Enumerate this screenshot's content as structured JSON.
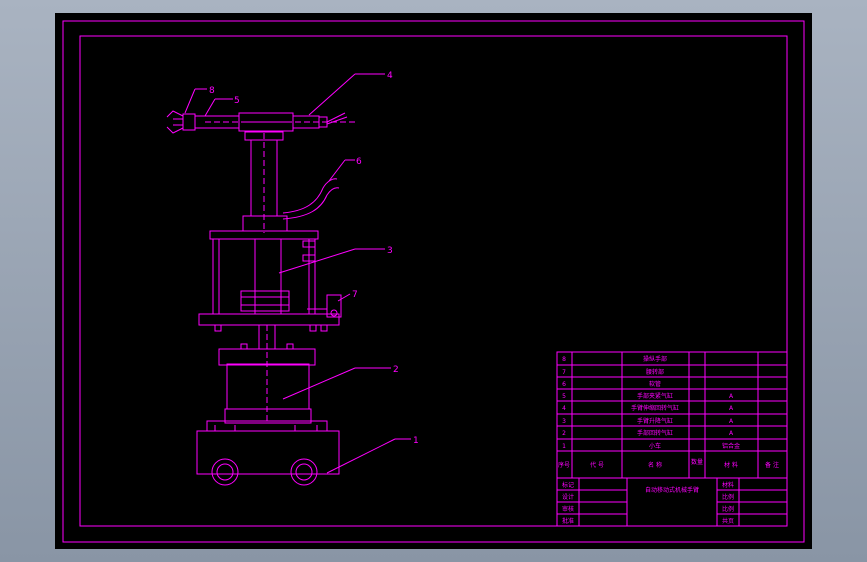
{
  "drawing": {
    "line_color": "#ff00ff",
    "background": "#000000",
    "callouts": [
      "1",
      "2",
      "3",
      "4",
      "5",
      "6",
      "7",
      "8"
    ],
    "parts_list": [
      {
        "no": "8",
        "name": "操纵手部",
        "qty": "",
        "material": "",
        "note": ""
      },
      {
        "no": "7",
        "name": "腰转部",
        "qty": "",
        "material": "",
        "note": ""
      },
      {
        "no": "6",
        "name": "软管",
        "qty": "",
        "material": "",
        "note": ""
      },
      {
        "no": "5",
        "name": "手部夹紧气缸",
        "qty": "",
        "material": "A",
        "note": ""
      },
      {
        "no": "4",
        "name": "手臂伸缩回转气缸",
        "qty": "",
        "material": "A",
        "note": ""
      },
      {
        "no": "3",
        "name": "手臂升降气缸",
        "qty": "",
        "material": "A",
        "note": ""
      },
      {
        "no": "2",
        "name": "手部回转气缸",
        "qty": "",
        "material": "A",
        "note": ""
      },
      {
        "no": "1",
        "name": "小车",
        "qty": "",
        "material": "铝合金",
        "note": ""
      }
    ],
    "parts_header": {
      "no": "序号",
      "code": "代 号",
      "name": "名 称",
      "qty": "数量",
      "material": "材 料",
      "note": "备 注"
    },
    "title_block": {
      "left_labels": [
        "标记",
        "设计",
        "审核",
        "批准"
      ],
      "title": "自动移动式机械手臂",
      "right_labels": [
        "材料",
        "比例",
        "比例",
        "共页"
      ]
    }
  }
}
